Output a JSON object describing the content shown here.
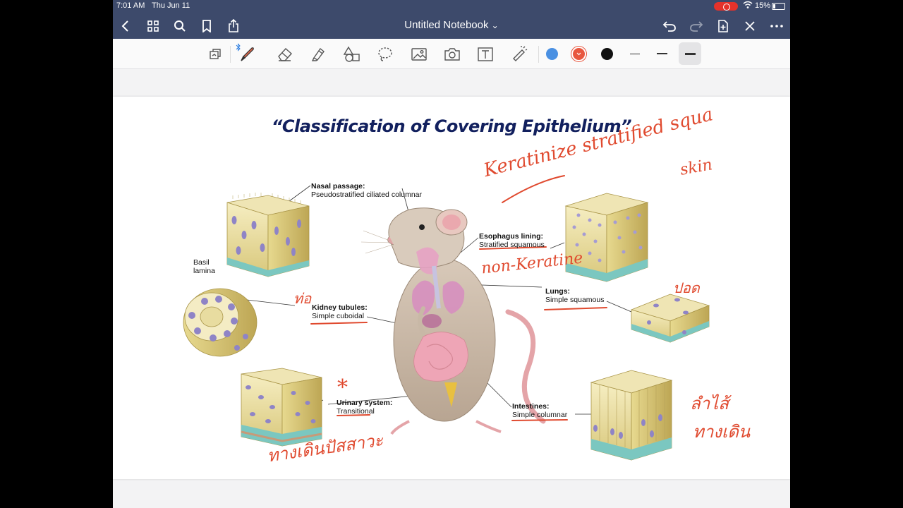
{
  "status": {
    "time": "7:01 AM",
    "date": "Thu Jun 11",
    "battery": "15%",
    "battery_level": 0.15
  },
  "nav": {
    "title": "Untitled Notebook",
    "title_chevron": "⌄",
    "icons": [
      "back-icon",
      "grid-icon",
      "search-icon",
      "bookmark-icon",
      "share-icon",
      "undo-icon",
      "redo-icon",
      "add-page-icon",
      "close-icon",
      "more-icon"
    ]
  },
  "toolbar": {
    "tools": [
      "read-only-icon",
      "pen-icon",
      "eraser-icon",
      "highlighter-icon",
      "shapes-icon",
      "lasso-icon",
      "image-icon",
      "camera-icon",
      "text-icon",
      "laser-icon"
    ],
    "colors": [
      "#4a90e2",
      "#e8573f",
      "#111111"
    ],
    "selected_color": "#e8573f"
  },
  "slide": {
    "title": "“Classification of  Covering Epithelium”",
    "labels": {
      "nasal_title": "Nasal passage:",
      "nasal_desc": "Pseudostratified ciliated columnar",
      "basil_1": "Basil",
      "basil_2": "lamina",
      "esophagus_title": "Esophagus lining:",
      "esophagus_desc": "Stratified squamous",
      "lungs_title": "Lungs:",
      "lungs_desc": "Simple squamous",
      "kidney_title": "Kidney tubules:",
      "kidney_desc": "Simple cuboidal",
      "urinary_title": "Urinary system:",
      "urinary_desc": "Transitional",
      "intestines_title": "Intestines:",
      "intestines_desc": "Simple columnar"
    }
  },
  "annotations": {
    "keratinize": "Keratinize stratified squa",
    "skin": "skin",
    "non_keratin": "non-Keratine",
    "lung_thai": "ปอด",
    "kidney_thai": "ท่อ",
    "star": "*",
    "urinary_thai": "ทางเดินปัสสาวะ",
    "intestine_thai_1": "ลำไส้",
    "intestine_thai_2": "ทางเดิน"
  }
}
